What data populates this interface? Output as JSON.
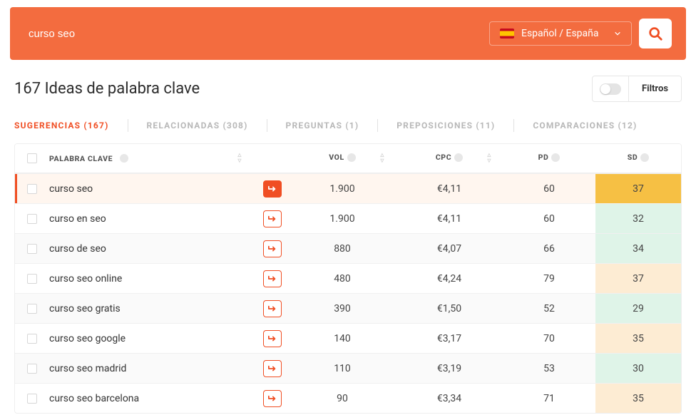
{
  "search": {
    "value": "curso seo",
    "placeholder": "curso seo"
  },
  "language": {
    "label": "Español / España"
  },
  "title_prefix": "167",
  "title_rest": "Ideas de palabra clave",
  "filters_label": "Filtros",
  "tabs": [
    {
      "label": "SUGERENCIAS (167)",
      "active": true
    },
    {
      "label": "RELACIONADAS (308)",
      "active": false
    },
    {
      "label": "PREGUNTAS (1)",
      "active": false
    },
    {
      "label": "PREPOSICIONES (11)",
      "active": false
    },
    {
      "label": "COMPARACIONES (12)",
      "active": false
    }
  ],
  "columns": {
    "kw": "PALABRA CLAVE",
    "vol": "VOL",
    "cpc": "CPC",
    "pd": "PD",
    "sd": "SD"
  },
  "rows": [
    {
      "keyword": "curso seo",
      "vol": "1.900",
      "cpc": "€4,11",
      "pd": "60",
      "sd": "37",
      "sd_class": "sd-orange",
      "selected": true
    },
    {
      "keyword": "curso en seo",
      "vol": "1.900",
      "cpc": "€4,11",
      "pd": "60",
      "sd": "32",
      "sd_class": "sd-mint",
      "selected": false
    },
    {
      "keyword": "curso de seo",
      "vol": "880",
      "cpc": "€4,07",
      "pd": "66",
      "sd": "34",
      "sd_class": "sd-mint",
      "selected": false
    },
    {
      "keyword": "curso seo online",
      "vol": "480",
      "cpc": "€4,24",
      "pd": "79",
      "sd": "37",
      "sd_class": "sd-peach",
      "selected": false
    },
    {
      "keyword": "curso seo gratis",
      "vol": "390",
      "cpc": "€1,50",
      "pd": "52",
      "sd": "29",
      "sd_class": "sd-mint",
      "selected": false
    },
    {
      "keyword": "curso seo google",
      "vol": "140",
      "cpc": "€3,17",
      "pd": "70",
      "sd": "35",
      "sd_class": "sd-peach",
      "selected": false
    },
    {
      "keyword": "curso seo madrid",
      "vol": "110",
      "cpc": "€3,19",
      "pd": "53",
      "sd": "30",
      "sd_class": "sd-mint",
      "selected": false
    },
    {
      "keyword": "curso seo barcelona",
      "vol": "90",
      "cpc": "€3,34",
      "pd": "71",
      "sd": "35",
      "sd_class": "sd-peach",
      "selected": false
    }
  ]
}
